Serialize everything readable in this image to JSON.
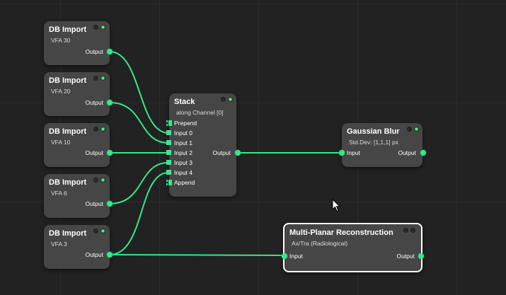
{
  "colors": {
    "canvas": "#222222",
    "node": "#464646",
    "wire": "#36e88c",
    "grid": "#2c2c2c"
  },
  "nodes": {
    "import_vfa30": {
      "title": "DB Import",
      "subtitle": "VFA 30",
      "output": "Output"
    },
    "import_vfa20": {
      "title": "DB Import",
      "subtitle": "VFA 20",
      "output": "Output"
    },
    "import_vfa10": {
      "title": "DB Import",
      "subtitle": "VFA 10",
      "output": "Output"
    },
    "import_vfa6": {
      "title": "DB Import",
      "subtitle": "VFA 6",
      "output": "Output"
    },
    "import_vfa3": {
      "title": "DB Import",
      "subtitle": "VFA 3",
      "output": "Output"
    },
    "stack": {
      "title": "Stack",
      "subtitle": "along Channel [0]",
      "inputs": [
        "Prepend",
        "Input 0",
        "Input 1",
        "Input 2",
        "Input 3",
        "Input 4",
        "Append"
      ],
      "output": "Output"
    },
    "gaussian_blur": {
      "title": "Gaussian Blur",
      "subtitle": "Std.Dev: [1,1,1] px",
      "input": "Input",
      "output": "Output"
    },
    "mpr": {
      "title": "Multi-Planar Reconstruction",
      "subtitle": "Ax/Tra (Radiological)",
      "input": "Input",
      "output": "Output"
    }
  },
  "icons": {
    "status_led": "status-led-icon",
    "cursor": "mouse-pointer-icon"
  }
}
